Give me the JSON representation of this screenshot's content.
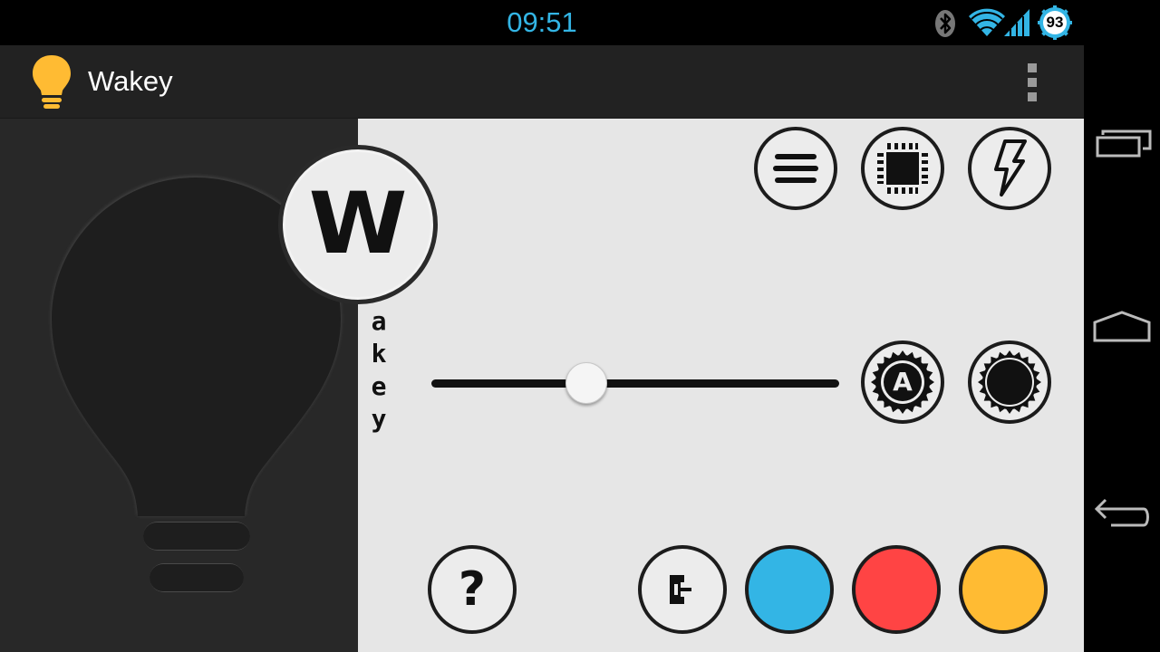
{
  "status_bar": {
    "time": "09:51",
    "battery_level": "93",
    "icons": [
      "bluetooth-icon",
      "wifi-icon",
      "signal-icon",
      "battery-icon"
    ],
    "accent_color": "#33b5e5"
  },
  "action_bar": {
    "title": "Wakey",
    "app_icon": "lightbulb-icon",
    "overflow_icon": "overflow-menu-icon"
  },
  "main": {
    "logo_letter": "W",
    "vertical_letters": [
      "a",
      "k",
      "e",
      "y"
    ],
    "brightness_slider": {
      "value": 0.38
    },
    "top_buttons": [
      "list-icon",
      "cpu-icon",
      "flash-icon"
    ],
    "mid_buttons": [
      "auto-brightness-icon",
      "brightness-icon"
    ],
    "help_label": "?",
    "color_swatches": [
      {
        "name": "blue",
        "color": "#33b5e5"
      },
      {
        "name": "red",
        "color": "#ff4444"
      },
      {
        "name": "yellow",
        "color": "#ffbb33"
      }
    ]
  },
  "nav_bar": {
    "buttons": [
      "recent-apps-icon",
      "home-icon",
      "back-icon"
    ]
  }
}
